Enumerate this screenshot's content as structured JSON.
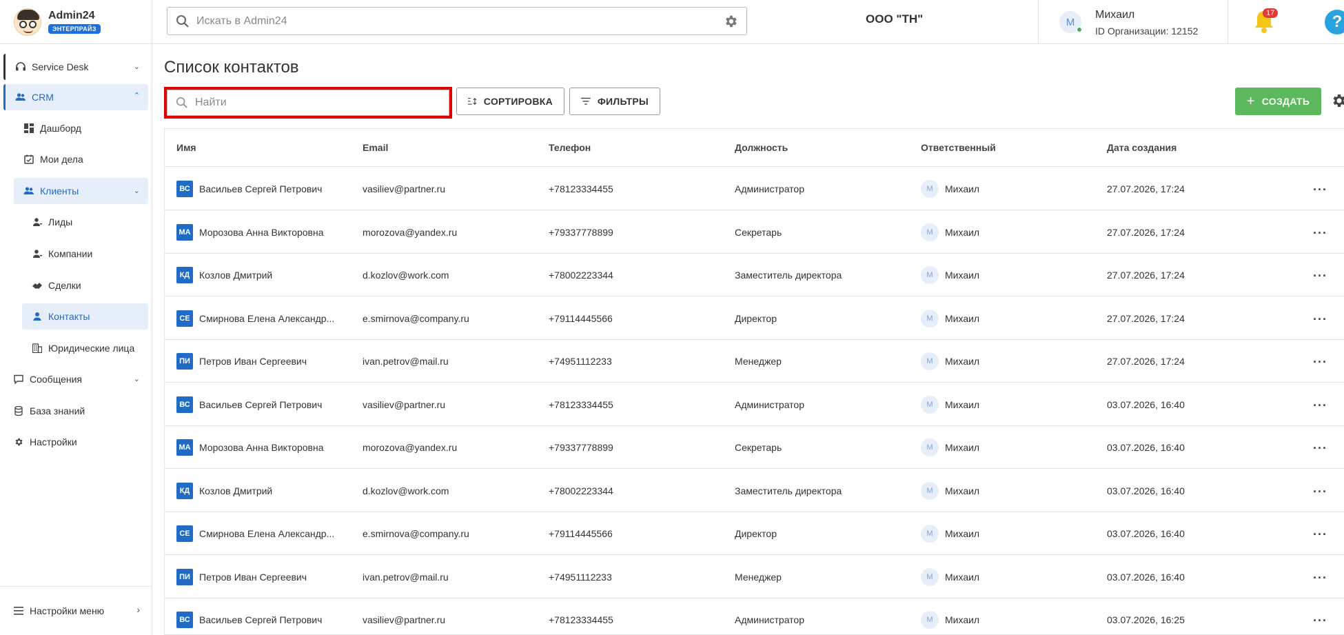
{
  "brand": {
    "name": "Admin24",
    "edition": "ЭНТЕРПРАЙЗ"
  },
  "header": {
    "search_placeholder": "Искать в Admin24",
    "org_name": "ООО \"ТН\"",
    "user_initial": "М",
    "user_name": "Михаил",
    "org_id": "ID Организации: 12152",
    "notifications_count": "17",
    "help_label": "?"
  },
  "sidebar": {
    "service_desk": "Service Desk",
    "crm": "CRM",
    "dashboard": "Дашборд",
    "my_tasks": "Мои дела",
    "clients": "Клиенты",
    "leads": "Лиды",
    "companies": "Компании",
    "deals": "Сделки",
    "contacts": "Контакты",
    "legal": "Юридические лица",
    "messages": "Сообщения",
    "knowledge": "База знаний",
    "settings": "Настройки",
    "menu_settings": "Настройки меню"
  },
  "main": {
    "title": "Список контактов",
    "find_placeholder": "Найти",
    "sort_label": "СОРТИРОВКА",
    "filter_label": "ФИЛЬТРЫ",
    "create_label": "СОЗДАТЬ"
  },
  "table": {
    "columns": [
      "Имя",
      "Email",
      "Телефон",
      "Должность",
      "Ответственный",
      "Дата создания"
    ],
    "rows": [
      {
        "initials": "ВС",
        "name": "Васильев Сергей Петрович",
        "email": "vasiliev@partner.ru",
        "phone": "+78123334455",
        "position": "Администратор",
        "resp_initial": "М",
        "resp": "Михаил",
        "date": "27.07.2026, 17:24"
      },
      {
        "initials": "МА",
        "name": "Морозова Анна Викторовна",
        "email": "morozova@yandex.ru",
        "phone": "+79337778899",
        "position": "Секретарь",
        "resp_initial": "М",
        "resp": "Михаил",
        "date": "27.07.2026, 17:24"
      },
      {
        "initials": "КД",
        "name": "Козлов Дмитрий",
        "email": "d.kozlov@work.com",
        "phone": "+78002223344",
        "position": "Заместитель директора",
        "resp_initial": "М",
        "resp": "Михаил",
        "date": "27.07.2026, 17:24"
      },
      {
        "initials": "СЕ",
        "name": "Смирнова Елена Александр...",
        "email": "e.smirnova@company.ru",
        "phone": "+79114445566",
        "position": "Директор",
        "resp_initial": "М",
        "resp": "Михаил",
        "date": "27.07.2026, 17:24"
      },
      {
        "initials": "ПИ",
        "name": "Петров Иван Сергеевич",
        "email": "ivan.petrov@mail.ru",
        "phone": "+74951112233",
        "position": "Менеджер",
        "resp_initial": "М",
        "resp": "Михаил",
        "date": "27.07.2026, 17:24"
      },
      {
        "initials": "ВС",
        "name": "Васильев Сергей Петрович",
        "email": "vasiliev@partner.ru",
        "phone": "+78123334455",
        "position": "Администратор",
        "resp_initial": "М",
        "resp": "Михаил",
        "date": "03.07.2026, 16:40"
      },
      {
        "initials": "МА",
        "name": "Морозова Анна Викторовна",
        "email": "morozova@yandex.ru",
        "phone": "+79337778899",
        "position": "Секретарь",
        "resp_initial": "М",
        "resp": "Михаил",
        "date": "03.07.2026, 16:40"
      },
      {
        "initials": "КД",
        "name": "Козлов Дмитрий",
        "email": "d.kozlov@work.com",
        "phone": "+78002223344",
        "position": "Заместитель директора",
        "resp_initial": "М",
        "resp": "Михаил",
        "date": "03.07.2026, 16:40"
      },
      {
        "initials": "СЕ",
        "name": "Смирнова Елена Александр...",
        "email": "e.smirnova@company.ru",
        "phone": "+79114445566",
        "position": "Директор",
        "resp_initial": "М",
        "resp": "Михаил",
        "date": "03.07.2026, 16:40"
      },
      {
        "initials": "ПИ",
        "name": "Петров Иван Сергеевич",
        "email": "ivan.petrov@mail.ru",
        "phone": "+74951112233",
        "position": "Менеджер",
        "resp_initial": "М",
        "resp": "Михаил",
        "date": "03.07.2026, 16:40"
      },
      {
        "initials": "ВС",
        "name": "Васильев Сергей Петрович",
        "email": "vasiliev@partner.ru",
        "phone": "+78123334455",
        "position": "Администратор",
        "resp_initial": "М",
        "resp": "Михаил",
        "date": "03.07.2026, 16:25"
      }
    ]
  },
  "colors": {
    "accent": "#1f6bc6",
    "create": "#5cb85c",
    "highlight": "#e00000",
    "badge": "#e53935"
  }
}
